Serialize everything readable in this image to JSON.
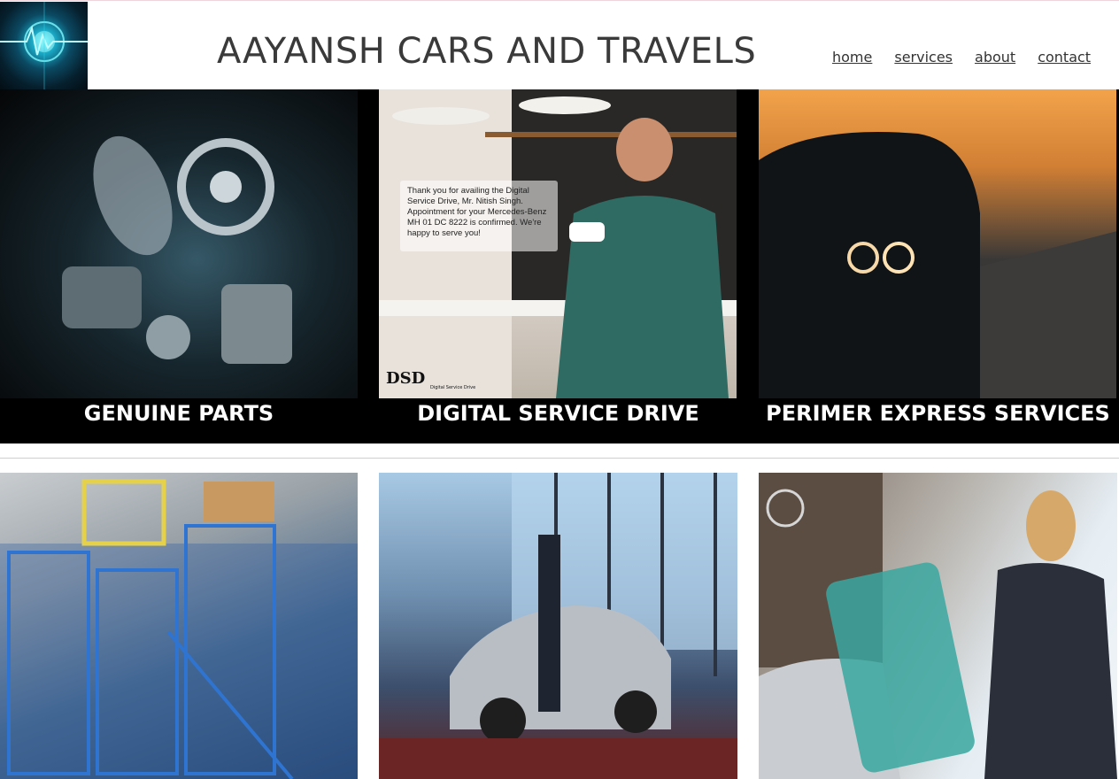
{
  "header": {
    "title": "AAYANSH CARS AND TRAVELS",
    "logo_icon": "heartbeat-logo-icon",
    "nav": [
      {
        "label": "home"
      },
      {
        "label": "services"
      },
      {
        "label": "about"
      },
      {
        "label": "contact"
      }
    ]
  },
  "cards": [
    {
      "caption": "GENUINE PARTS",
      "image": "engine-parts-image"
    },
    {
      "caption": "DIGITAL SERVICE DRIVE",
      "image": "man-with-coffee-phone-image"
    },
    {
      "caption": "PERIMER EXPRESS SERVICES",
      "image": "car-headlights-sunset-image"
    }
  ],
  "dsd_message": "Thank you for availing the Digital Service Drive, Mr. Nitish Singh. Appointment for your Mercedes-Benz MH 01 DC 8222 is confirmed. We're happy to serve you!",
  "dsd_logo": {
    "text": "DSD",
    "sub": "Digital Service Drive"
  },
  "gallery": [
    {
      "image": "warehouse-shelves-image"
    },
    {
      "image": "mechanics-car-workshop-image"
    },
    {
      "image": "mercedes-showroom-phone-image"
    }
  ],
  "colors": {
    "caption_bg": "#000000",
    "title": "#3a3a3a",
    "caption_text": "#ffffff"
  }
}
